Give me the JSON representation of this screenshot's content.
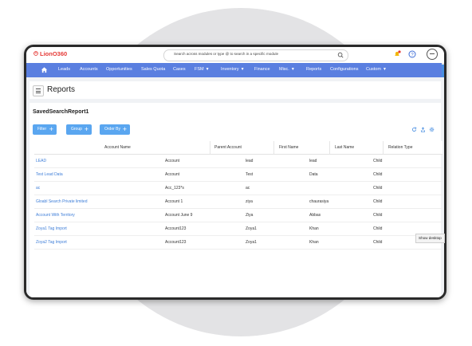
{
  "app": {
    "logo_text": "LionO360",
    "search_placeholder": "Search across modules or type @ to search in a specific module"
  },
  "nav": {
    "items": [
      {
        "label": "Leads"
      },
      {
        "label": "Accounts"
      },
      {
        "label": "Opportunities"
      },
      {
        "label": "Sales Quota"
      },
      {
        "label": "Cases"
      },
      {
        "label": "FSM",
        "dropdown": true
      },
      {
        "label": "Inventory",
        "dropdown": true
      },
      {
        "label": "Finance"
      },
      {
        "label": "Misc.",
        "dropdown": true
      },
      {
        "label": "Reports"
      },
      {
        "label": "Configurations"
      },
      {
        "label": "Custom",
        "dropdown": true
      }
    ]
  },
  "page": {
    "title": "Reports",
    "report_name": "SavedSearchReport1"
  },
  "toolbar": {
    "filter_label": "Filter",
    "group_label": "Group",
    "order_label": "Order By"
  },
  "table": {
    "headers": [
      "Account Name",
      "Parent Account",
      "First Name",
      "Last Name",
      "Relation Type"
    ],
    "rows": [
      [
        "LEAD",
        "Account",
        "lead",
        "lead",
        "Child"
      ],
      [
        "Test Lead Data",
        "Account",
        "Test",
        "Data",
        "Child"
      ],
      [
        "ac",
        "Acc_123*s",
        "ac",
        "",
        "Child"
      ],
      [
        "Gloabl Search Private limited",
        "Account 1",
        "ziya",
        "chaurasiya",
        "Child"
      ],
      [
        "Account With Territory",
        "Account June 9",
        "Ziya",
        "Abbas",
        "Child"
      ],
      [
        "Zoya1 Tag Import",
        "Account123",
        "Zoya1",
        "Khan",
        "Child"
      ],
      [
        "Zoya2 Tag Import",
        "Account123",
        "Zoya1",
        "Khan",
        "Child"
      ]
    ]
  },
  "tooltip": {
    "text": "Show desktop"
  },
  "colors": {
    "nav_bg": "#5a7fe0",
    "button_bg": "#5aa6f0",
    "link": "#3e7ed8",
    "logo": "#e53935"
  },
  "icons": [
    "home-icon",
    "search-icon",
    "bell-icon",
    "help-icon",
    "avatar",
    "menu-icon",
    "refresh-icon",
    "export-icon",
    "settings-icon"
  ]
}
